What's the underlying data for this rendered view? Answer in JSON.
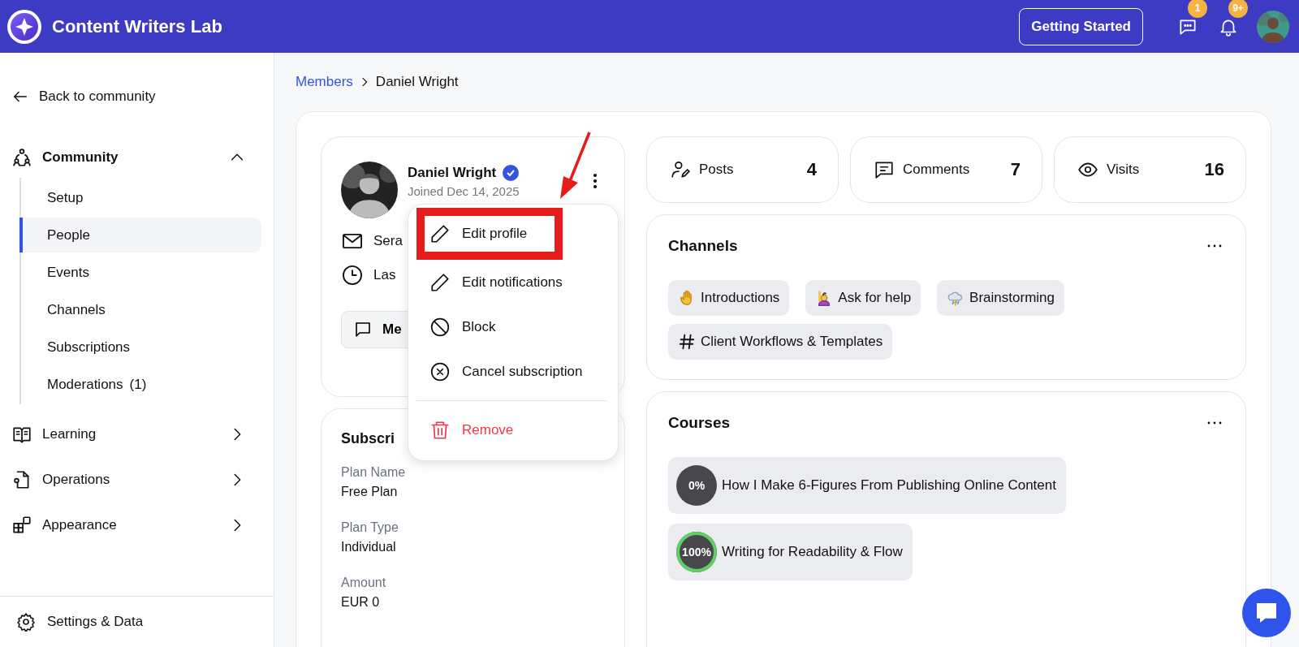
{
  "app": {
    "name": "Content Writers Lab"
  },
  "header": {
    "getting_started": "Getting Started",
    "message_badge": "1",
    "notification_badge": "9+"
  },
  "sidebar": {
    "back": "Back to community",
    "sections": [
      {
        "kind": "community",
        "label": "Community",
        "expanded": true,
        "children": [
          {
            "label": "Setup",
            "selected": false
          },
          {
            "label": "People",
            "selected": true
          },
          {
            "label": "Events",
            "selected": false
          },
          {
            "label": "Channels",
            "selected": false
          },
          {
            "label": "Subscriptions",
            "selected": false
          },
          {
            "label": "Moderations",
            "count": "(1)",
            "selected": false
          }
        ]
      },
      {
        "kind": "learning",
        "label": "Learning",
        "expanded": false
      },
      {
        "kind": "operations",
        "label": "Operations",
        "expanded": false
      },
      {
        "kind": "appearance",
        "label": "Appearance",
        "expanded": false
      }
    ],
    "footer": "Settings & Data"
  },
  "breadcrumb": [
    {
      "label": "Members",
      "link": true
    },
    {
      "label": "Daniel Wright",
      "link": false
    }
  ],
  "profile": {
    "name": "Daniel Wright",
    "verified": true,
    "joined": "Joined Dec 14, 2025",
    "email": "Sera",
    "last_seen": "Las",
    "message_button": "Me"
  },
  "subscription": {
    "title": "Subscri",
    "fields": [
      {
        "label": "Plan Name",
        "value": "Free Plan"
      },
      {
        "label": "Plan Type",
        "value": "Individual"
      },
      {
        "label": "Amount",
        "value": "EUR 0"
      }
    ]
  },
  "stats": [
    {
      "kind": "posts",
      "label": "Posts",
      "value": "4"
    },
    {
      "kind": "comments",
      "label": "Comments",
      "value": "7"
    },
    {
      "kind": "visits",
      "label": "Visits",
      "value": "16"
    }
  ],
  "channels": {
    "title": "Channels",
    "items": [
      {
        "kind": "wave",
        "label": "Introductions"
      },
      {
        "kind": "raise-hand",
        "label": "Ask for help"
      },
      {
        "kind": "cloud",
        "label": "Brainstorming"
      },
      {
        "kind": "hash",
        "label": "Client Workflows & Templates"
      }
    ]
  },
  "courses": {
    "title": "Courses",
    "items": [
      {
        "progress": "0%",
        "level": 0,
        "title": "How I Make 6-Figures From Publishing Online Content"
      },
      {
        "progress": "100%",
        "level": 1,
        "title": "Writing for Readability & Flow"
      }
    ]
  },
  "menu": {
    "items": [
      {
        "kind": "edit",
        "label": "Edit profile",
        "highlighted": true
      },
      {
        "kind": "edit",
        "label": "Edit notifications",
        "highlighted": false
      },
      {
        "kind": "block",
        "label": "Block",
        "highlighted": false
      },
      {
        "kind": "cancel",
        "label": "Cancel subscription",
        "highlighted": false
      },
      {
        "kind": "remove",
        "label": "Remove",
        "highlighted": false
      }
    ]
  }
}
